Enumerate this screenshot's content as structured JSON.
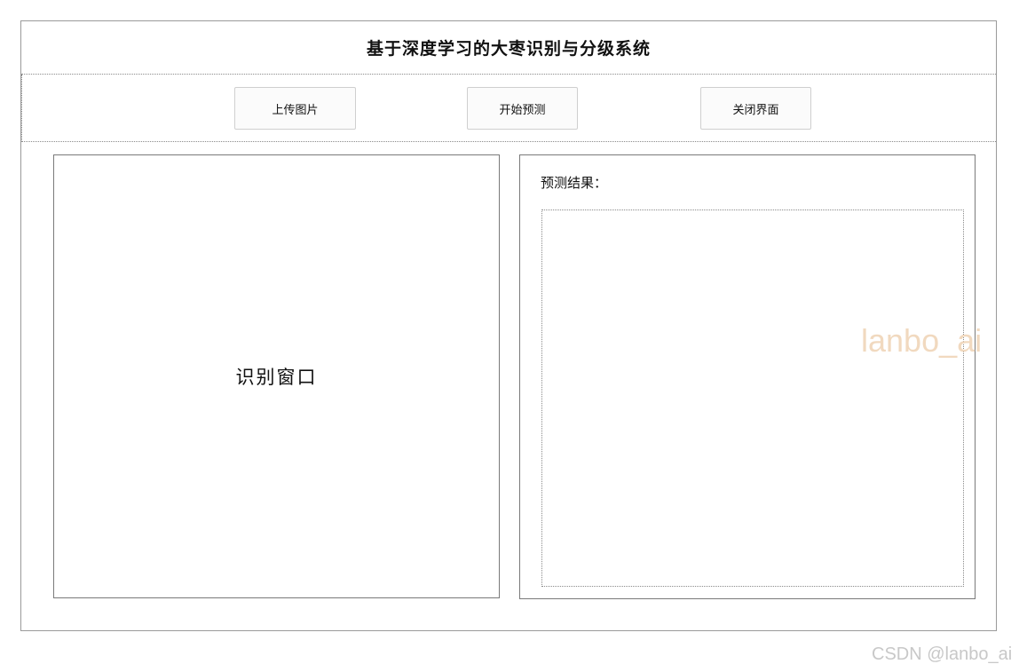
{
  "app": {
    "title": "基于深度学习的大枣识别与分级系统"
  },
  "toolbar": {
    "upload_label": "上传图片",
    "predict_label": "开始预测",
    "close_label": "关闭界面"
  },
  "image_panel": {
    "label": "识别窗口"
  },
  "result_panel": {
    "label": "预测结果：",
    "text": ""
  },
  "watermarks": {
    "center": "lanbo_ai",
    "footer": "CSDN @lanbo_ai"
  },
  "colors": {
    "border": "#7a7a7a",
    "watermark_center": "#f1d9bf",
    "watermark_footer": "#c8c8c8"
  }
}
